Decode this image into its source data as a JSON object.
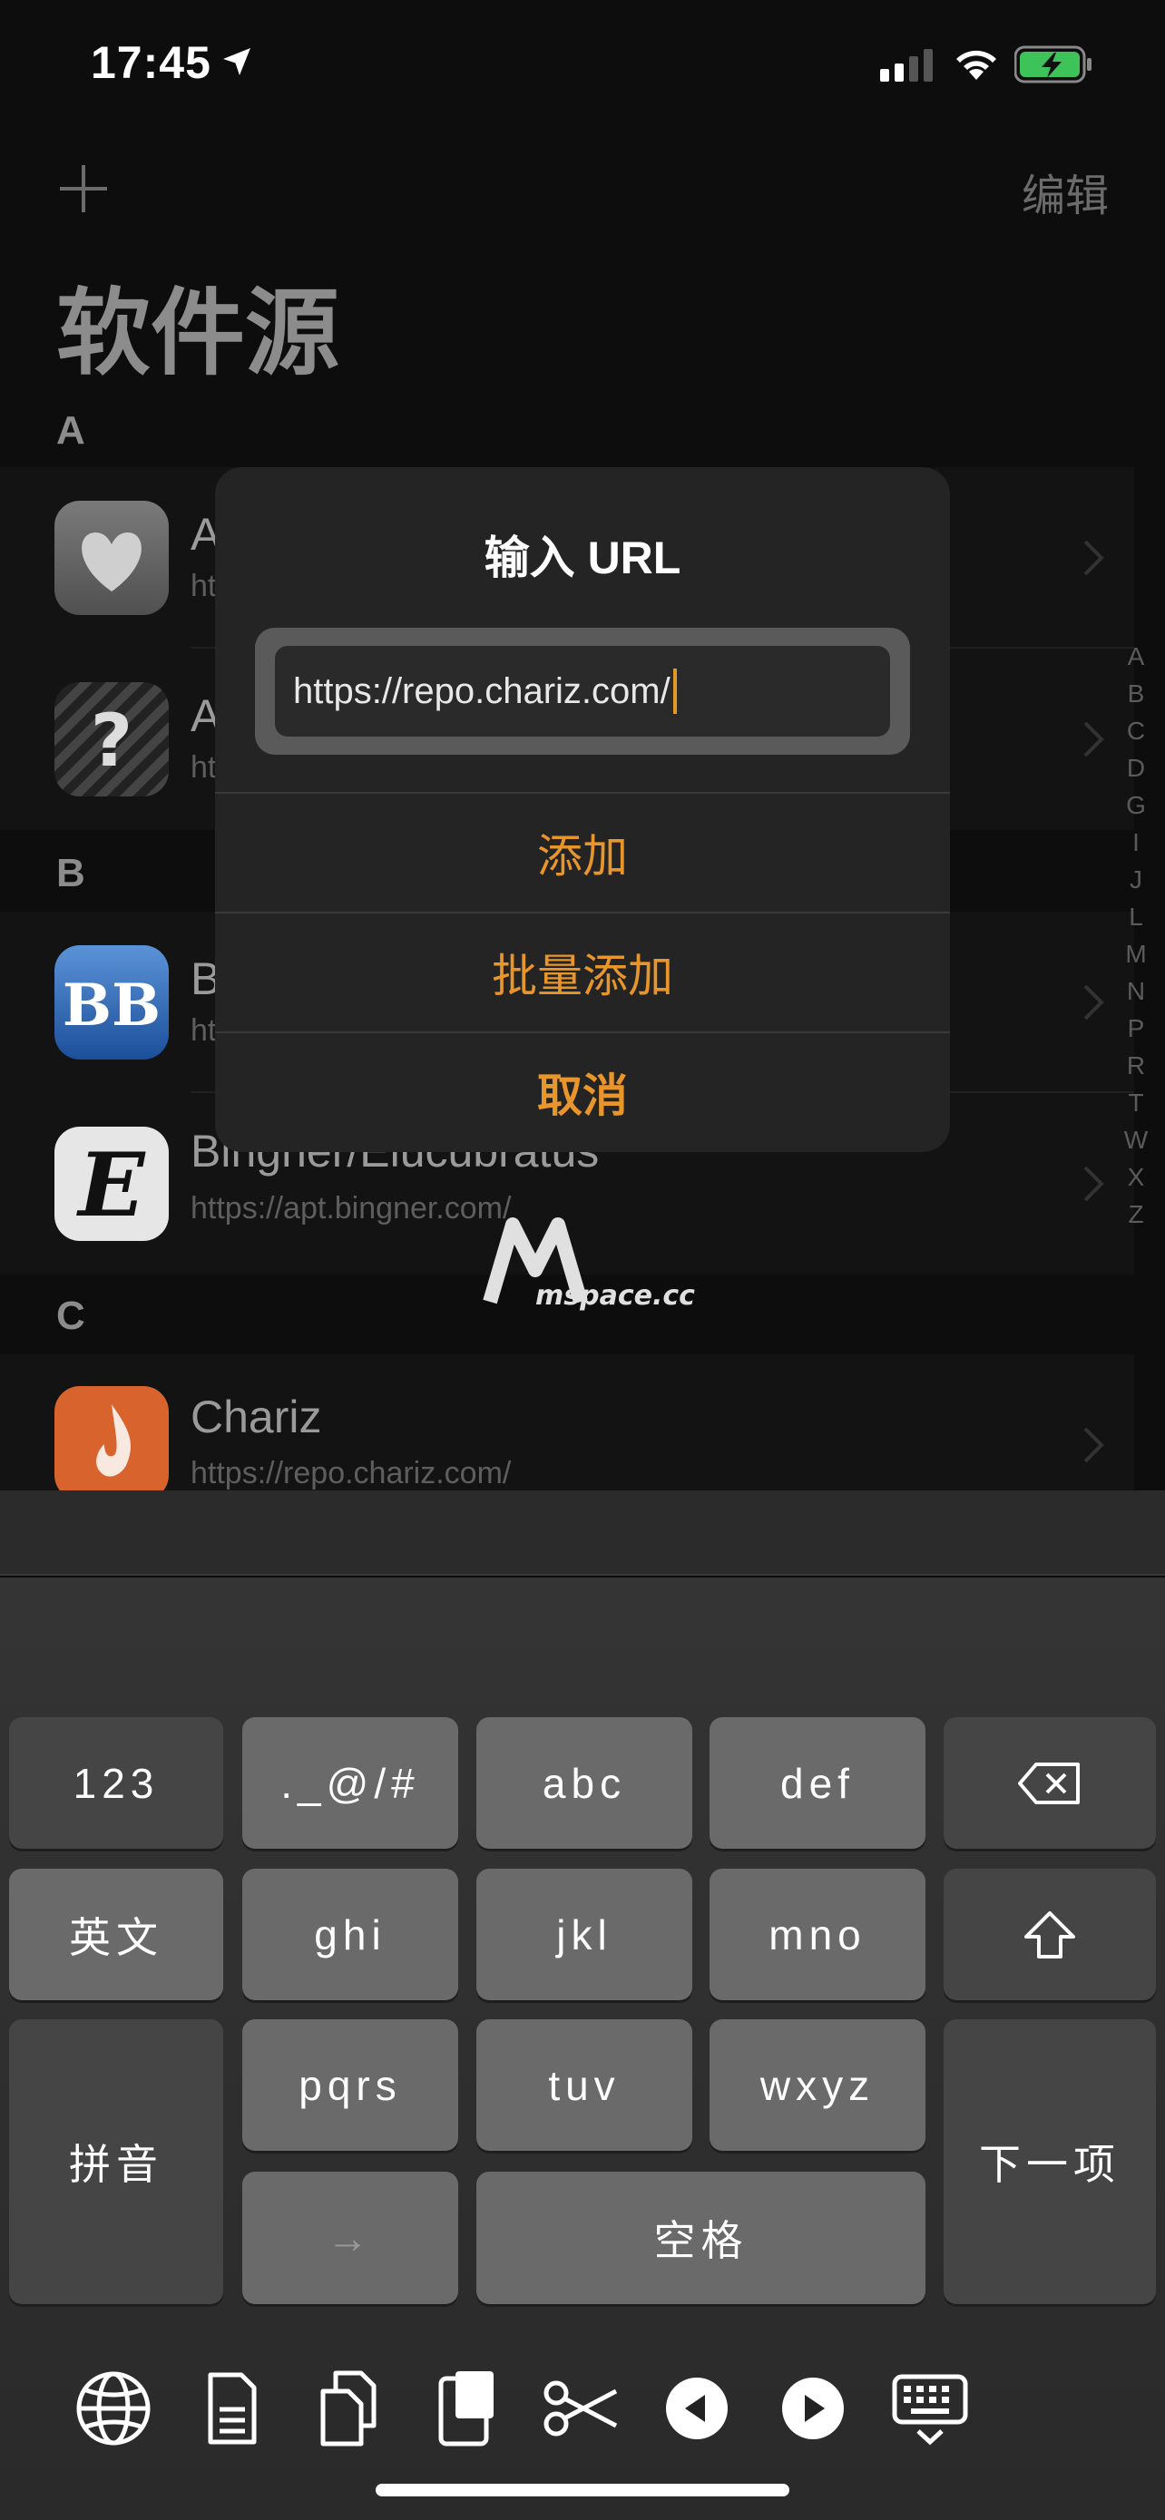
{
  "status_bar": {
    "time": "17:45"
  },
  "nav": {
    "edit_label": "编辑",
    "title": "软件源"
  },
  "sections": [
    {
      "letter": "A",
      "rows": [
        {
          "title": "A",
          "subtitle": "ht"
        },
        {
          "title": "A",
          "subtitle": "ht"
        }
      ]
    },
    {
      "letter": "B",
      "rows": [
        {
          "title": "B",
          "subtitle": "ht"
        },
        {
          "title": "Bingner/Elucubratus",
          "subtitle": "https://apt.bingner.com/"
        }
      ]
    },
    {
      "letter": "C",
      "rows": [
        {
          "title": "Chariz",
          "subtitle": "https://repo.chariz.com/"
        }
      ]
    }
  ],
  "index_letters": [
    "A",
    "B",
    "C",
    "D",
    "G",
    "I",
    "J",
    "L",
    "M",
    "N",
    "P",
    "R",
    "T",
    "W",
    "X",
    "Z"
  ],
  "watermark": {
    "text": "mspace.cc"
  },
  "alert": {
    "title": "输入 URL",
    "input_value": "https://repo.chariz.com/",
    "buttons": {
      "add": "添加",
      "batch_add": "批量添加",
      "cancel": "取消"
    }
  },
  "keyboard": {
    "keys": {
      "num": "123",
      "sym": "._@/#",
      "abc": "abc",
      "def": "def",
      "eng": "英文",
      "ghi": "ghi",
      "jkl": "jkl",
      "mno": "mno",
      "pinyin": "拼音",
      "pqrs": "pqrs",
      "tuv": "tuv",
      "wxyz": "wxyz",
      "arrow": "→",
      "space": "空格",
      "next": "下一项"
    }
  },
  "colors": {
    "accent": "#e8962b",
    "battery": "#3ec25a"
  }
}
